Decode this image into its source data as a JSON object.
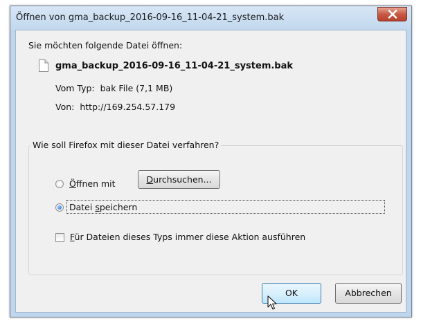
{
  "window": {
    "title": "Öffnen von gma_backup_2016-09-16_11-04-21_system.bak",
    "close_icon": "close-x-icon"
  },
  "dialog": {
    "prompt": "Sie möchten folgende Datei öffnen:",
    "file_icon": "document-icon",
    "filename": "gma_backup_2016-09-16_11-04-21_system.bak",
    "type_label": "Vom Typ:",
    "type_value": "bak File (7,1 MB)",
    "from_label": "Von:",
    "from_value": "http://169.254.57.179"
  },
  "action_group": {
    "legend": "Wie soll Firefox mit dieser Datei verfahren?",
    "open_with": {
      "mnemonic": "Ö",
      "rest": "ffnen mit",
      "selected": false
    },
    "browse_button": {
      "mnemonic": "D",
      "rest": "urchsuchen..."
    },
    "save_file": {
      "prefix": "Datei ",
      "mnemonic": "s",
      "rest": "peichern",
      "selected": true
    },
    "always_action": {
      "mnemonic": "F",
      "rest": "ür Dateien dieses Typs immer diese Aktion ausführen",
      "checked": false
    }
  },
  "buttons": {
    "ok": "OK",
    "cancel": "Abbrechen"
  },
  "colors": {
    "title_bar": "#c2d8ee",
    "close_button": "#c75a45",
    "dialog_background": "#f0f0f0",
    "ok_button_border": "#3c7fb1"
  }
}
